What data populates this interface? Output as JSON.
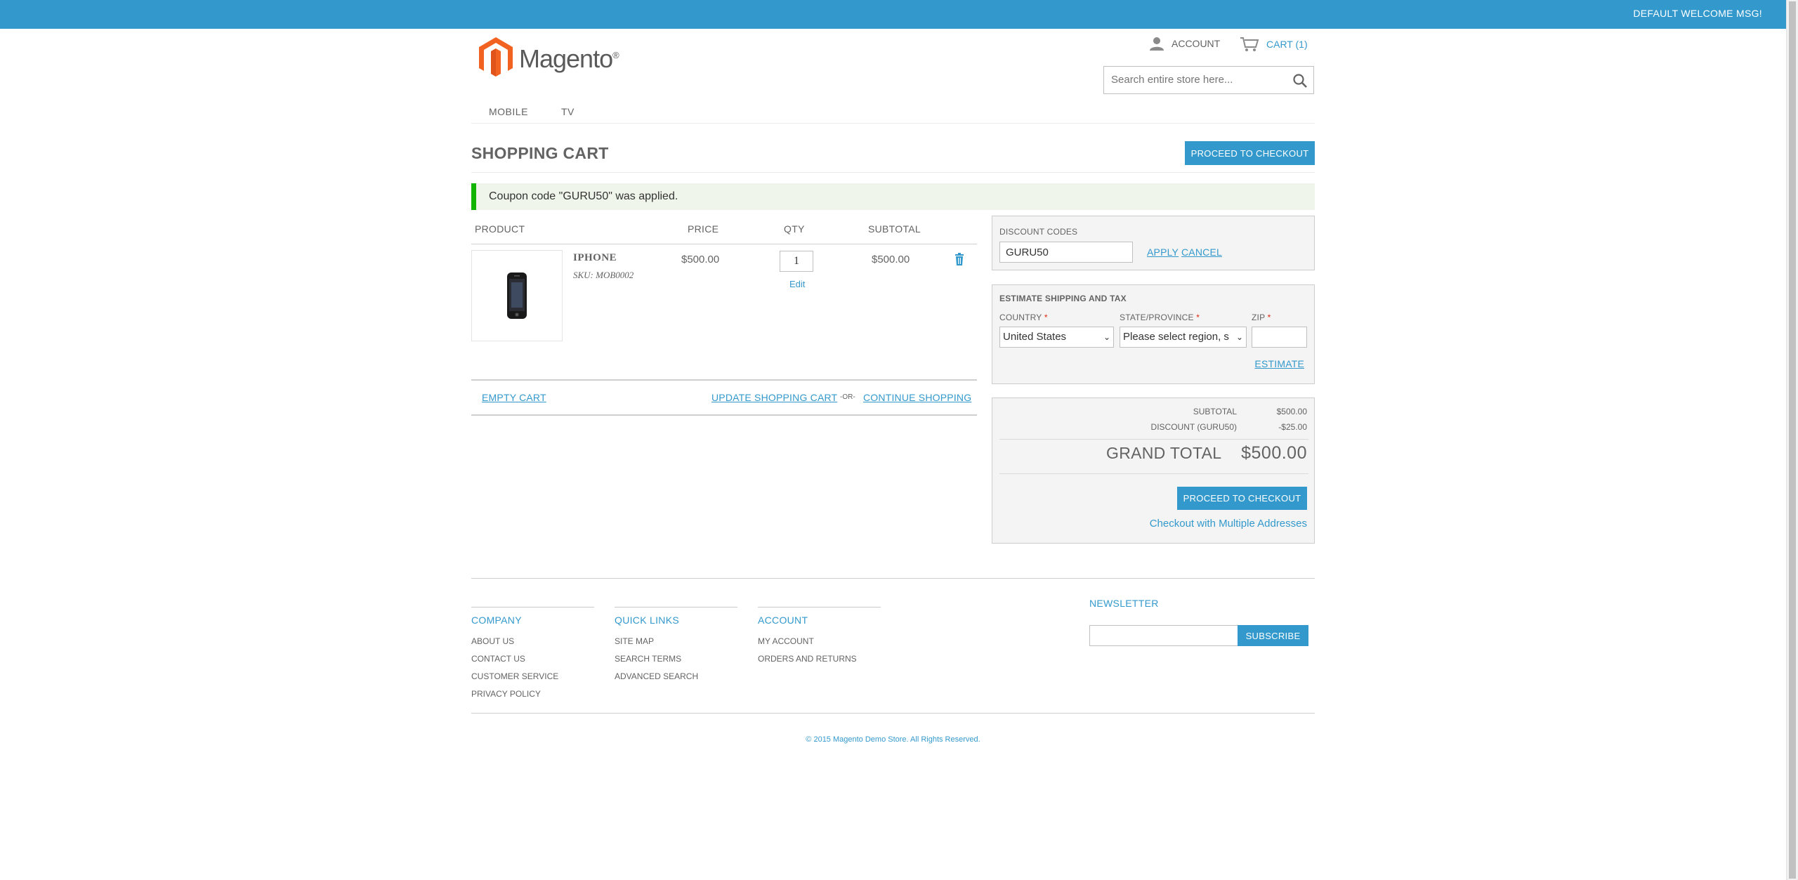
{
  "topbar": {
    "welcome": "DEFAULT WELCOME MSG!"
  },
  "header": {
    "logo_text": "Magento",
    "account_label": "ACCOUNT",
    "cart_label": "CART (1)",
    "search_placeholder": "Search entire store here..."
  },
  "nav": {
    "items": [
      "MOBILE",
      "TV"
    ]
  },
  "page": {
    "title": "SHOPPING CART",
    "checkout_label": "PROCEED TO CHECKOUT",
    "message": "Coupon code \"GURU50\" was applied."
  },
  "cart": {
    "columns": [
      "PRODUCT",
      "PRICE",
      "QTY",
      "SUBTOTAL"
    ],
    "items": [
      {
        "name": "IPHONE",
        "sku": "SKU: MOB0002",
        "price": "$500.00",
        "qty": "1",
        "edit": "Edit",
        "subtotal": "$500.00"
      }
    ],
    "empty_cart": "EMPTY CART",
    "update_cart": "UPDATE SHOPPING CART",
    "or": "-OR-",
    "continue": "CONTINUE SHOPPING"
  },
  "discount": {
    "label": "DISCOUNT CODES",
    "code": "GURU50",
    "apply": "APPLY",
    "cancel": "CANCEL"
  },
  "shipping": {
    "title": "ESTIMATE SHIPPING AND TAX",
    "country_label": "COUNTRY",
    "state_label": "STATE/PROVINCE",
    "zip_label": "ZIP",
    "required_mark": "*",
    "country_value": "United States",
    "state_value": "Please select region, s",
    "estimate": "ESTIMATE"
  },
  "totals": {
    "subtotal_label": "SUBTOTAL",
    "subtotal_value": "$500.00",
    "discount_label": "DISCOUNT (GURU50)",
    "discount_value": "-$25.00",
    "grand_label": "GRAND TOTAL",
    "grand_value": "$500.00",
    "checkout_label": "PROCEED TO CHECKOUT",
    "multi_label": "Checkout with Multiple Addresses"
  },
  "footer": {
    "company": {
      "title": "COMPANY",
      "links": [
        "ABOUT US",
        "CONTACT US",
        "CUSTOMER SERVICE",
        "PRIVACY POLICY"
      ]
    },
    "quick": {
      "title": "QUICK LINKS",
      "links": [
        "SITE MAP",
        "SEARCH TERMS",
        "ADVANCED SEARCH"
      ]
    },
    "account": {
      "title": "ACCOUNT",
      "links": [
        "MY ACCOUNT",
        "ORDERS AND RETURNS"
      ]
    },
    "newsletter_title": "NEWSLETTER",
    "subscribe": "SUBSCRIBE",
    "copyright": "© 2015 Magento Demo Store. All Rights Reserved."
  },
  "colors": {
    "accent": "#3399cc",
    "success": "#11b400",
    "required": "#df280a"
  },
  "icons": {
    "account": "user-icon",
    "cart": "cart-icon",
    "search": "search-icon",
    "delete": "trash-icon",
    "logo": "magento-logo-icon"
  }
}
